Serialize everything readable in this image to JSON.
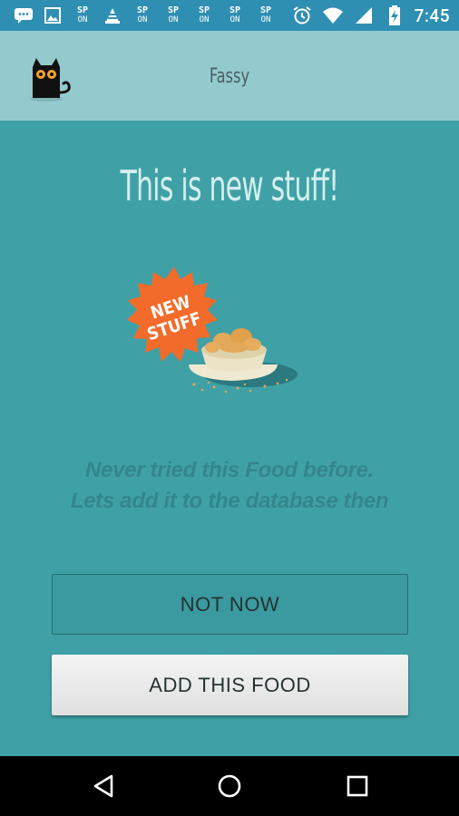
{
  "status_bar": {
    "time": "7:45",
    "sp_badges": [
      {
        "top": "SP",
        "bottom": "ON"
      },
      {
        "top": "SP",
        "bottom": "ON"
      },
      {
        "top": "SP",
        "bottom": "ON"
      },
      {
        "top": "SP",
        "bottom": "ON"
      },
      {
        "top": "SP",
        "bottom": "ON"
      },
      {
        "top": "SP",
        "bottom": "ON"
      }
    ],
    "icons": [
      "message-icon",
      "image-icon",
      "vlc-icon",
      "alarm-icon",
      "wifi-icon",
      "signal-icon",
      "battery-charging-icon"
    ]
  },
  "toolbar": {
    "title": "Fassy",
    "logo": "black-cat-icon"
  },
  "main": {
    "headline": "This is new stuff!",
    "badge_line1": "NEW",
    "badge_line2": "STUFF",
    "message_line1": "Never tried this Food before.",
    "message_line2": "Lets add it to the database then"
  },
  "buttons": {
    "not_now": "NOT NOW",
    "add_food": "ADD THIS FOOD"
  },
  "nav_bar": {
    "icons": [
      "back-icon",
      "home-icon",
      "recents-icon"
    ]
  },
  "colors": {
    "status_bar": "#2f8fb3",
    "toolbar": "#93cace",
    "background": "#3fa1a6",
    "headline": "#d4efee",
    "badge": "#f26b2a",
    "message": "#33868c"
  }
}
